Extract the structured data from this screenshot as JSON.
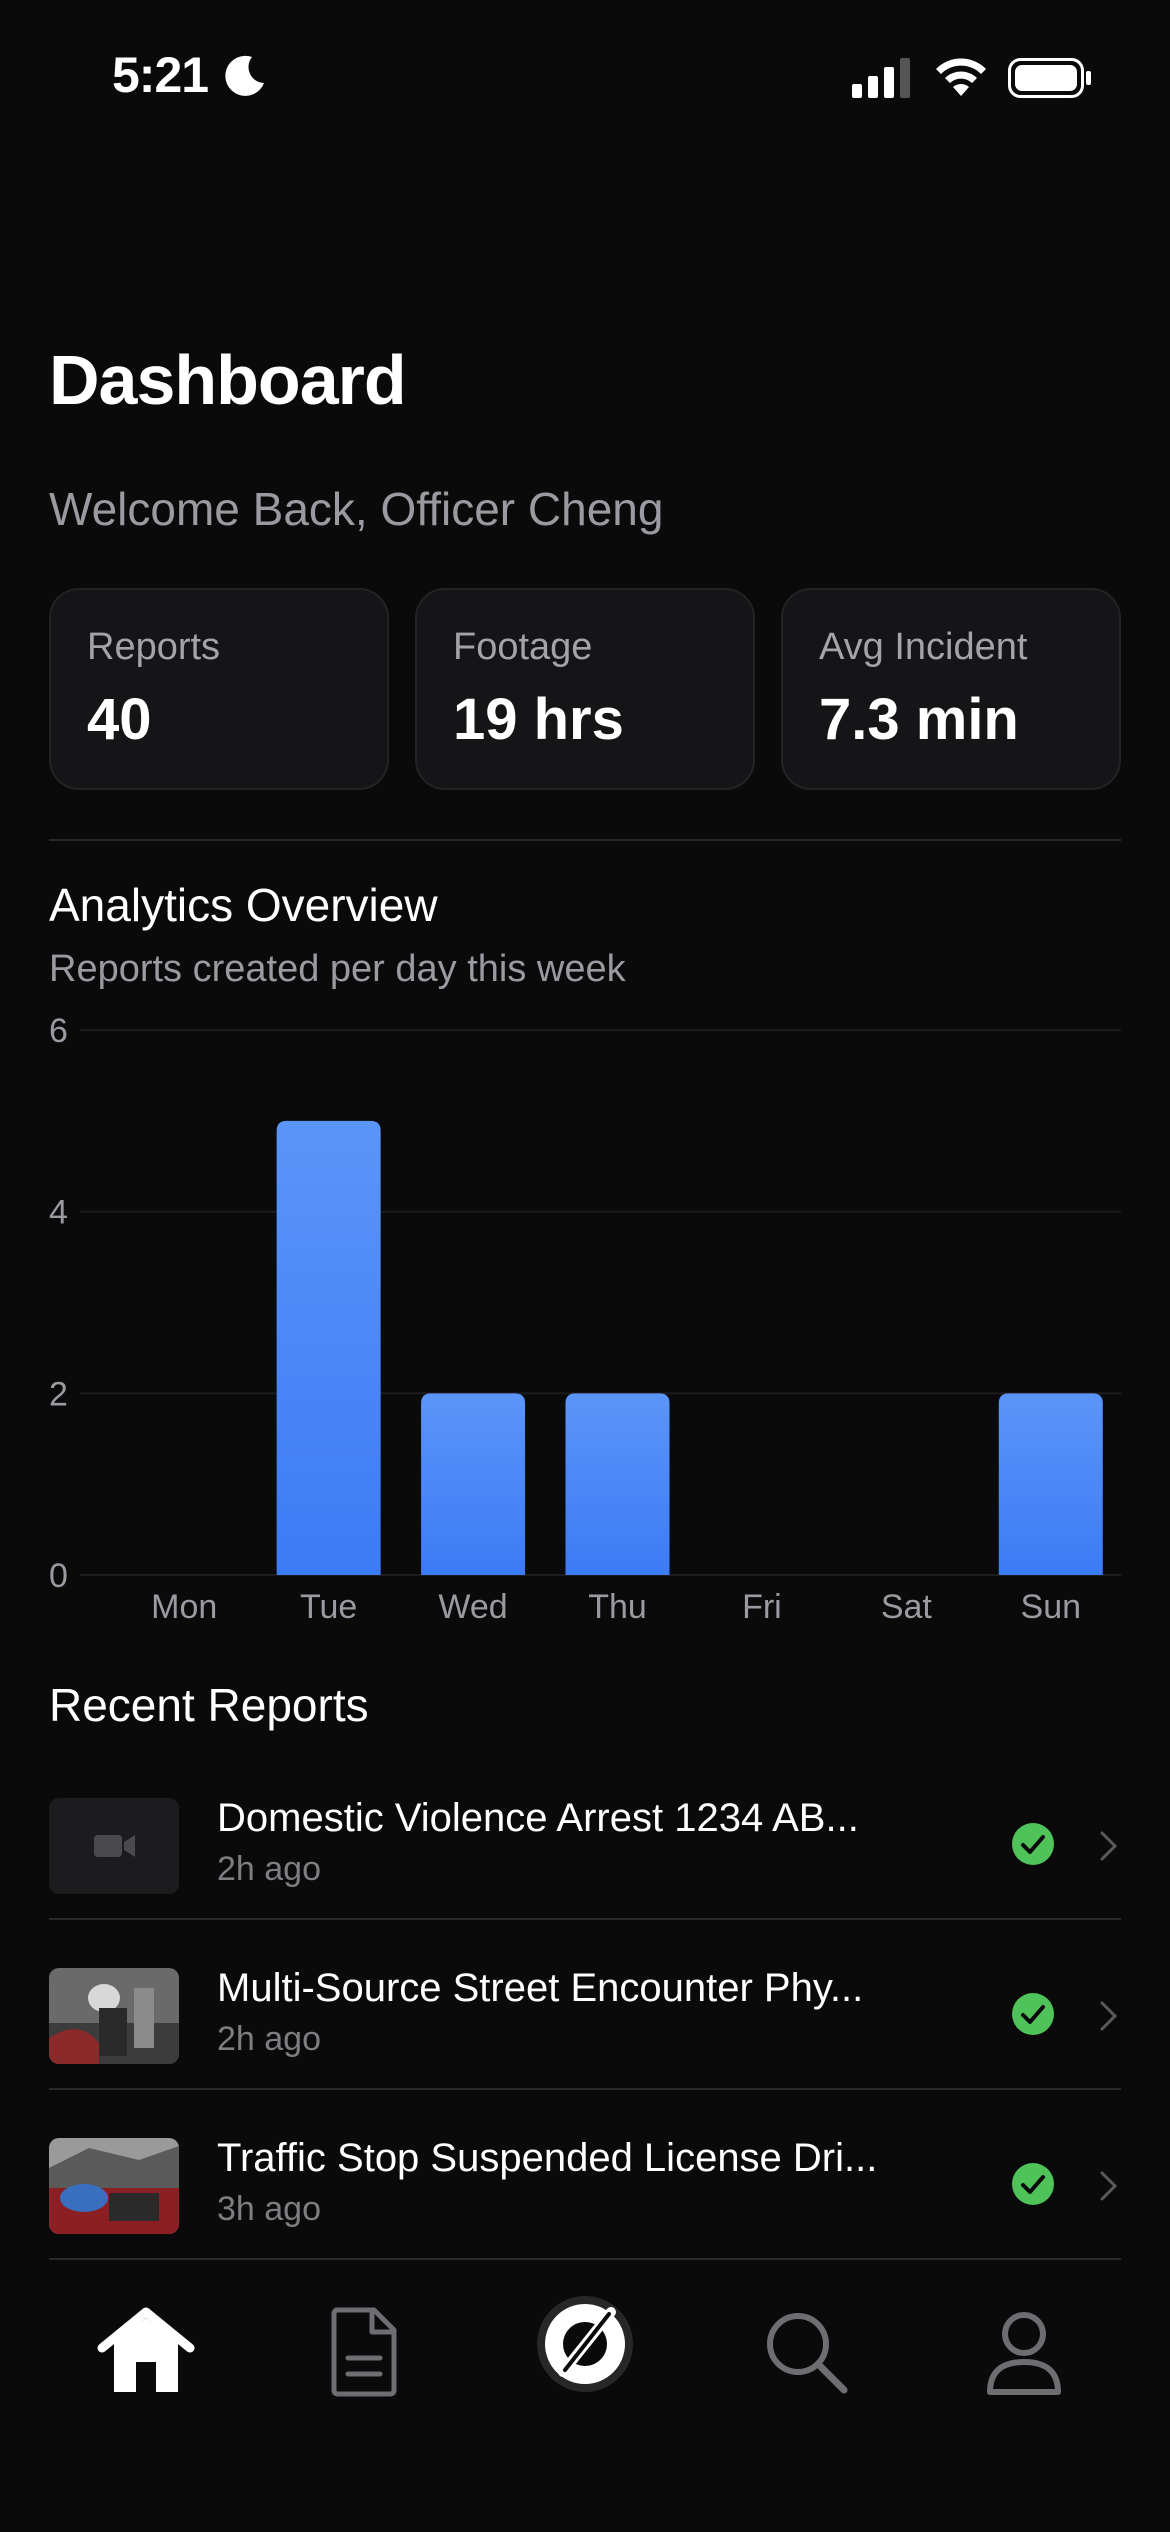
{
  "status_bar": {
    "time": "5:21",
    "icons": [
      "moon-icon",
      "signal-icon",
      "wifi-icon",
      "battery-icon"
    ]
  },
  "header": {
    "title": "Dashboard",
    "welcome": "Welcome Back, Officer Cheng"
  },
  "stats": [
    {
      "label": "Reports",
      "value": "40"
    },
    {
      "label": "Footage",
      "value": "19 hrs"
    },
    {
      "label": "Avg Incident",
      "value": "7.3 min"
    }
  ],
  "analytics": {
    "title": "Analytics Overview",
    "subtitle": "Reports created per day this week"
  },
  "chart_data": {
    "type": "bar",
    "categories": [
      "Mon",
      "Tue",
      "Wed",
      "Thu",
      "Fri",
      "Sat",
      "Sun"
    ],
    "values": [
      0,
      5,
      2,
      2,
      0,
      0,
      2
    ],
    "yticks": [
      "0",
      "2",
      "4",
      "6"
    ],
    "ylim": [
      0,
      6
    ],
    "grid": true,
    "bar_color": "#3b7bf6",
    "bar_color_top": "#5b95f8"
  },
  "recent": {
    "title": "Recent Reports",
    "items": [
      {
        "title": "Domestic Violence Arrest 1234 AB...",
        "time": "2h ago",
        "thumb": "video-placeholder"
      },
      {
        "title": "Multi-Source Street Encounter Phy...",
        "time": "2h ago",
        "thumb": "photo"
      },
      {
        "title": "Traffic Stop Suspended License Dri...",
        "time": "3h ago",
        "thumb": "photo"
      }
    ]
  },
  "tabbar": {
    "items": [
      "home-icon",
      "document-icon",
      "record-icon",
      "search-icon",
      "profile-icon"
    ]
  },
  "colors": {
    "accent": "#3b7bf6",
    "success": "#4fc25a",
    "background": "#0a0a0b"
  }
}
